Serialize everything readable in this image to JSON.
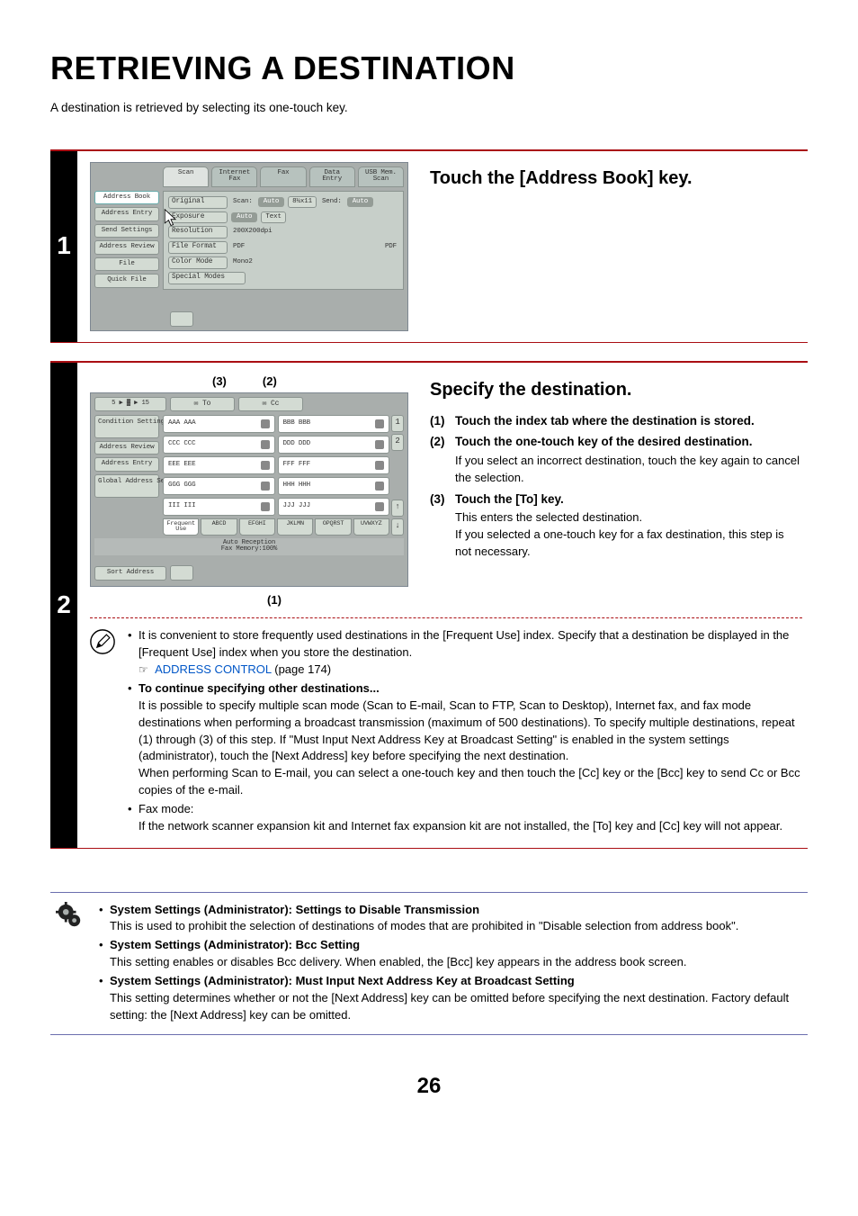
{
  "title": "RETRIEVING A DESTINATION",
  "intro": "A destination is retrieved by selecting its one-touch key.",
  "step1": {
    "num": "1",
    "title": "Touch the [Address Book] key.",
    "mock": {
      "tabs": [
        "Scan",
        "Internet Fax",
        "Fax",
        "Data Entry",
        "USB Mem. Scan"
      ],
      "side": [
        "Address Book",
        "Address Entry",
        "Send Settings",
        "Address Review",
        "File",
        "Quick File"
      ],
      "rows": [
        {
          "label": "Original",
          "a": "Scan:",
          "av": "Auto",
          "b": "8½x11",
          "c": "Send:",
          "cv": "Auto"
        },
        {
          "label": "Exposure",
          "v": "Auto",
          "extra": "Text"
        },
        {
          "label": "Resolution",
          "v": "200X200dpi"
        },
        {
          "label": "File Format",
          "v": "PDF",
          "right": "PDF"
        },
        {
          "label": "Color Mode",
          "v": "Mono2"
        },
        {
          "label": "Special Modes"
        }
      ]
    }
  },
  "step2": {
    "num": "2",
    "title": "Specify the destination.",
    "callouts": {
      "c3": "(3)",
      "c2": "(2)",
      "c1": "(1)"
    },
    "mock": {
      "breadcrumb": "5 ▶ ▓ ▶ 15",
      "to": "To",
      "cc": "Cc",
      "side": [
        "Condition Settings",
        "Address Review",
        "Address Entry",
        "Global Address Search"
      ],
      "addrs": [
        [
          "AAA AAA",
          "BBB BBB"
        ],
        [
          "CCC CCC",
          "DDD DDD"
        ],
        [
          "EEE EEE",
          "FFF FFF"
        ],
        [
          "GGG GGG",
          "HHH HHH"
        ],
        [
          "III III",
          "JJJ JJJ"
        ]
      ],
      "nums": [
        "1",
        "2"
      ],
      "bot_tabs": [
        "Frequent Use",
        "ABCD",
        "EFGHI",
        "JKLMN",
        "OPQRST",
        "UVWXYZ"
      ],
      "sort": "Sort Address",
      "status_a": "Auto Reception",
      "status_b": "Fax Memory:100%"
    },
    "items": [
      {
        "n": "(1)",
        "strong": "Touch the index tab where the destination is stored."
      },
      {
        "n": "(2)",
        "strong": "Touch the one-touch key of the desired destination.",
        "desc": "If you select an incorrect destination, touch the key again to cancel the selection."
      },
      {
        "n": "(3)",
        "strong": "Touch the [To] key.",
        "desc": "This enters the selected destination.\nIf you selected a one-touch key for a fax destination, this step is not necessary."
      }
    ],
    "note_bullets": [
      {
        "pre": "It is convenient to store frequently used destinations in the [Frequent Use] index. Specify that a destination be displayed in the [Frequent Use] index when you store the destination."
      },
      {
        "strong": "To continue specifying other destinations...",
        "body": "It is possible to specify multiple scan mode (Scan to E-mail, Scan to FTP, Scan to Desktop), Internet fax, and fax mode destinations when performing a broadcast transmission (maximum of 500 destinations). To specify multiple destinations, repeat (1) through (3) of this step. If \"Must Input Next Address Key at Broadcast Setting\" is enabled in the system settings (administrator), touch the [Next Address] key before specifying the next destination.\nWhen performing Scan to E-mail, you can select a one-touch key and then touch the [Cc] key or the [Bcc] key to send Cc or Bcc copies of the e-mail."
      },
      {
        "pre": "Fax mode:",
        "body": "If the network scanner expansion kit and Internet fax expansion kit are not installed, the [To] key and [Cc] key will not appear."
      }
    ],
    "link": {
      "label": "ADDRESS CONTROL",
      "page": " (page 174)",
      "pointer": "☞ "
    }
  },
  "footnotes": [
    {
      "strong": "System Settings (Administrator): Settings to Disable Transmission",
      "body": "This is used to prohibit the selection of destinations of modes that are prohibited in \"Disable selection from address book\"."
    },
    {
      "strong": "System Settings (Administrator): Bcc Setting",
      "body": "This setting enables or disables Bcc delivery. When enabled, the [Bcc] key appears in the address book screen."
    },
    {
      "strong": "System Settings (Administrator): Must Input Next Address Key at Broadcast Setting",
      "body": "This setting determines whether or not the [Next Address] key can be omitted before specifying the next destination. Factory default setting: the [Next Address] key can be omitted."
    }
  ],
  "page_number": "26"
}
